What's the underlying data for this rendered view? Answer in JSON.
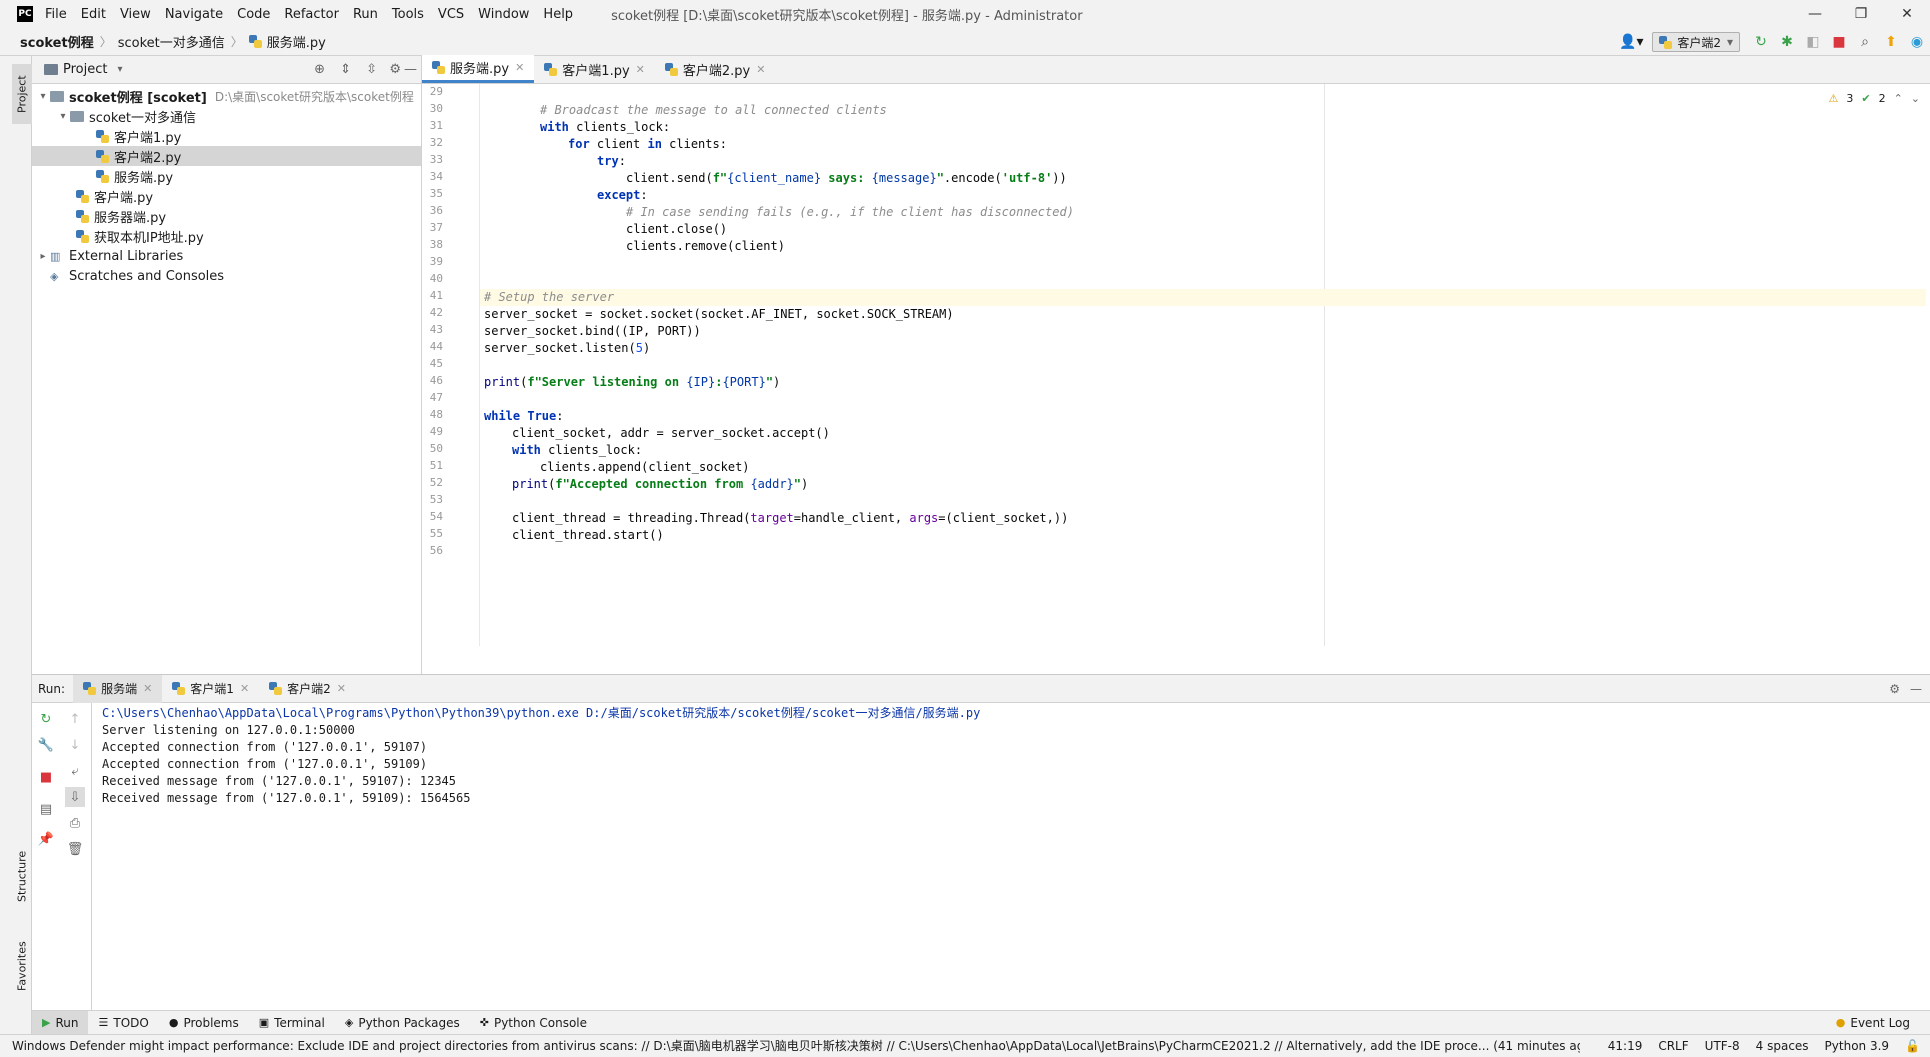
{
  "app": {
    "logo": "PC",
    "menu": [
      "File",
      "Edit",
      "View",
      "Navigate",
      "Code",
      "Refactor",
      "Run",
      "Tools",
      "VCS",
      "Window",
      "Help"
    ],
    "window_title": "scoket例程 [D:\\桌面\\scoket研究版本\\scoket例程] - 服务端.py - Administrator"
  },
  "breadcrumb": [
    "scoket例程",
    "scoket一对多通信",
    "服务端.py"
  ],
  "toolbar": {
    "run_config": "客户端2"
  },
  "project": {
    "title": "Project",
    "tree": [
      {
        "label": "scoket例程 [scoket]",
        "hint": "D:\\桌面\\scoket研究版本\\scoket例程"
      },
      {
        "label": "scoket一对多通信"
      },
      {
        "label": "客户端1.py"
      },
      {
        "label": "客户端2.py"
      },
      {
        "label": "服务端.py"
      },
      {
        "label": "客户端.py"
      },
      {
        "label": "服务器端.py"
      },
      {
        "label": "获取本机IP地址.py"
      },
      {
        "label": "External Libraries"
      },
      {
        "label": "Scratches and Consoles"
      }
    ]
  },
  "editor": {
    "tabs": [
      "服务端.py",
      "客户端1.py",
      "客户端2.py"
    ],
    "inspections": {
      "warnings": "3",
      "weak": "2"
    },
    "line_numbers": [
      "29",
      "30",
      "31",
      "32",
      "33",
      "34",
      "35",
      "36",
      "37",
      "38",
      "39",
      "40",
      "41",
      "42",
      "43",
      "44",
      "45",
      "46",
      "47",
      "48",
      "49",
      "50",
      "51",
      "52",
      "53",
      "54",
      "55",
      "56"
    ],
    "code": {
      "l30": "# Broadcast the message to all connected clients",
      "l31_kw": "with",
      "l31": " clients_lock:",
      "l32_kw": "for",
      "l32a": " client ",
      "l32_kw2": "in",
      "l32b": " clients:",
      "l33_kw": "try",
      "l33": ":",
      "l34a": "client.send(",
      "l34_f": "f\"",
      "l34b": "{client_name}",
      "l34_s": " says: ",
      "l34c": "{message}",
      "l34_e": "\"",
      "l34d": ".encode(",
      "l34_u": "'utf-8'",
      "l34f": "))",
      "l35_kw": "except",
      "l35": ":",
      "l36": "# In case sending fails (e.g., if the client has disconnected)",
      "l37": "client.close()",
      "l38": "clients.remove(client)",
      "l41": "# Setup the server",
      "l42": "server_socket = socket.socket(socket.AF_INET, socket.SOCK_STREAM)",
      "l43": "server_socket.bind((IP, PORT))",
      "l44a": "server_socket.listen(",
      "l44n": "5",
      "l44b": ")",
      "l46_p": "print",
      "l46a": "(",
      "l46_s": "f\"Server listening on ",
      "l46b": "{IP}",
      "l46_s2": ":",
      "l46c": "{PORT}",
      "l46_s3": "\"",
      "l46d": ")",
      "l48_kw": "while",
      "l48_kw2": "True",
      "l48": ":",
      "l49": "client_socket, addr = server_socket.accept()",
      "l50_kw": "with",
      "l50": " clients_lock:",
      "l51": "clients.append(client_socket)",
      "l52_p": "print",
      "l52a": "(",
      "l52_s": "f\"Accepted connection from ",
      "l52b": "{addr}",
      "l52_s2": "\"",
      "l52c": ")",
      "l54a": "client_thread = threading.Thread(",
      "l54_p1": "target",
      "l54b": "=handle_client, ",
      "l54_p2": "args",
      "l54c": "=(client_socket,))",
      "l55": "client_thread.start()"
    }
  },
  "run": {
    "label": "Run:",
    "tabs": [
      "服务端",
      "客户端1",
      "客户端2"
    ],
    "console": [
      "C:\\Users\\Chenhao\\AppData\\Local\\Programs\\Python\\Python39\\python.exe D:/桌面/scoket研究版本/scoket例程/scoket一对多通信/服务端.py",
      "Server listening on 127.0.0.1:50000",
      "Accepted connection from ('127.0.0.1', 59107)",
      "Accepted connection from ('127.0.0.1', 59109)",
      "Received message from ('127.0.0.1', 59107): 12345",
      "Received message from ('127.0.0.1', 59109): 1564565"
    ]
  },
  "tool_tabs": [
    "Run",
    "TODO",
    "Problems",
    "Terminal",
    "Python Packages",
    "Python Console"
  ],
  "event_log": "Event Log",
  "side_tabs": {
    "project": "Project",
    "structure": "Structure",
    "favorites": "Favorites"
  },
  "status": {
    "message": "Windows Defender might impact performance: Exclude IDE and project directories from antivirus scans: // D:\\桌面\\脑电机器学习\\脑电贝叶斯核决策树 // C:\\Users\\Chenhao\\AppData\\Local\\JetBrains\\PyCharmCE2021.2 // Alternatively, add the IDE proce... (41 minutes ago)",
    "position": "41:19",
    "line_sep": "CRLF",
    "encoding": "UTF-8",
    "indent": "4 spaces",
    "interpreter": "Python 3.9"
  }
}
